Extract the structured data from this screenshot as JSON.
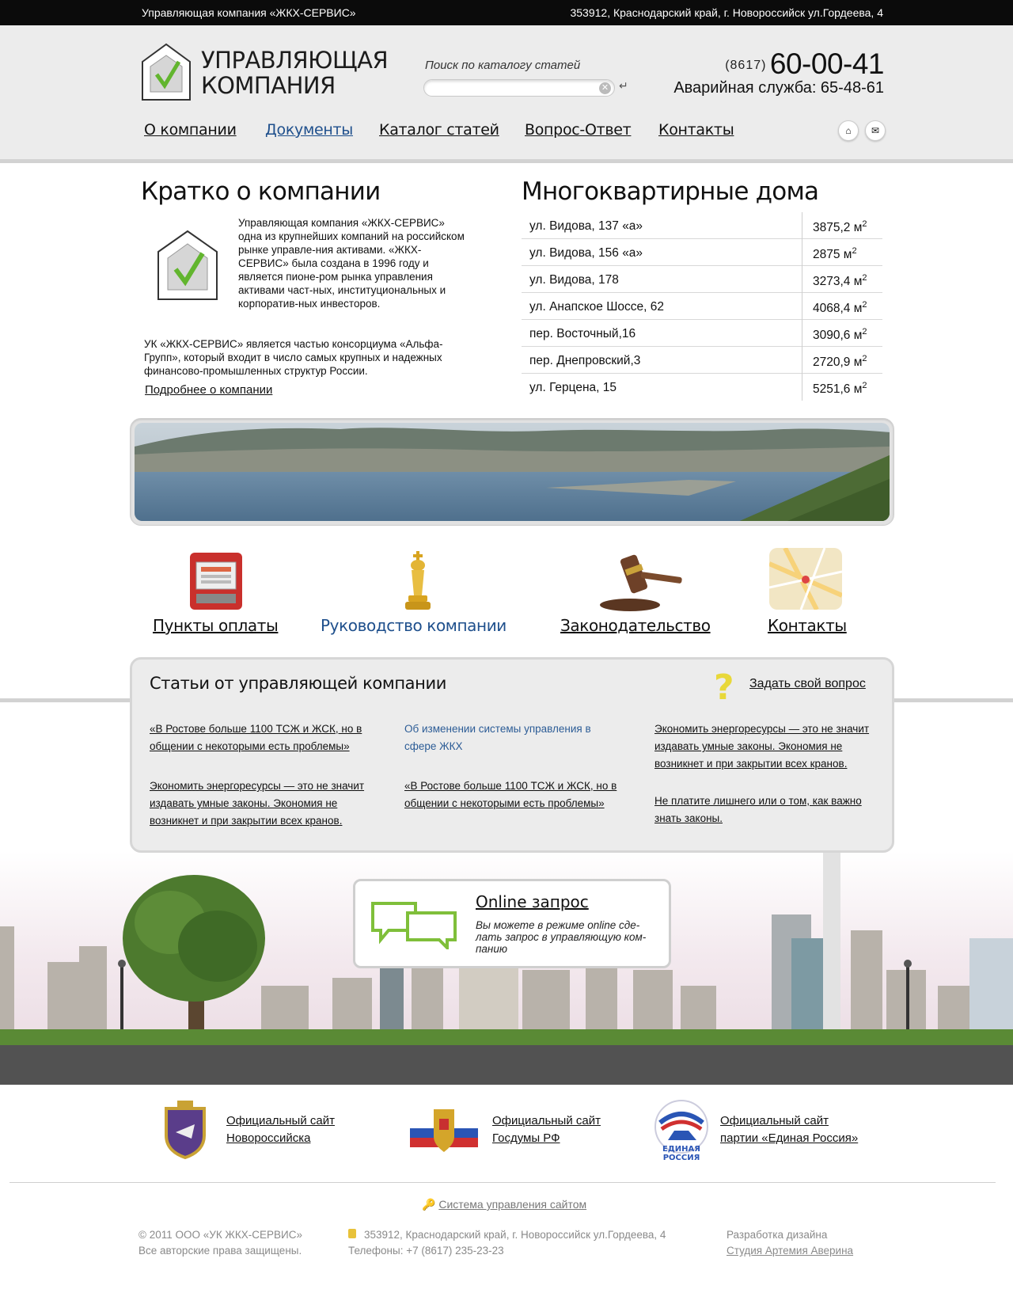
{
  "topbar": {
    "company": "Управляющая компания «ЖКХ-СЕРВИС»",
    "address": "353912, Краснодарский край, г. Новороссийск ул.Гордеева, 4"
  },
  "header": {
    "logo_line1": "УПРАВЛЯЮЩАЯ",
    "logo_line2": "КОМПАНИЯ",
    "search_label": "Поиск по каталогу статей",
    "search_value": "",
    "phone_code": "(8617)",
    "phone_number": "60-00-41",
    "emergency": "Аварийная служба: 65-48-61",
    "nav": [
      "О компании",
      "Документы",
      "Каталог статей",
      "Вопрос-Ответ",
      "Контакты"
    ],
    "icons": [
      "home-icon",
      "mail-icon"
    ]
  },
  "about": {
    "title": "Кратко о компании",
    "p1": "Управляющая компания «ЖКХ-СЕРВИС»  одна из крупнейших компаний на российском рынке управле-ния активами. «ЖКХ-СЕРВИС» была создана в 1996 году и является пионе-ром рынка управления активами част-ных, институциональных и корпоратив-ных инвесторов.",
    "p2": "УК «ЖКХ-СЕРВИС» является частью консорциума «Альфа-Групп», который входит в число самых крупных и надежных финансово-промышленных структур России.",
    "more": "Подробнее о компании"
  },
  "houses": {
    "title": "Многоквартирные дома",
    "unit": "м",
    "unit_sup": "2",
    "rows": [
      {
        "address": "ул. Видова, 137 «а»",
        "area": "3875,2"
      },
      {
        "address": "ул. Видова, 156 «а»",
        "area": "2875"
      },
      {
        "address": "ул. Видова, 178",
        "area": "3273,4"
      },
      {
        "address": "ул. Анапское Шоссе, 62",
        "area": "4068,4"
      },
      {
        "address": "пер. Восточный,16",
        "area": "3090,6"
      },
      {
        "address": "пер. Днепровский,3",
        "area": "2720,9"
      },
      {
        "address": "ул. Герцена, 15",
        "area": "5251,6"
      }
    ]
  },
  "quicklinks": [
    "Пункты оплаты",
    "Руководство компании",
    "Законодательство",
    "Контакты"
  ],
  "articles": {
    "title": "Статьи  от управляющей компании",
    "ask": "Задать свой вопрос",
    "items": [
      "«В Ростове больше 1100 ТСЖ и ЖСК, но в общении с некоторыми есть проблемы»",
      "Экономить энергоресурсы — это не значит издавать умные законы. Экономия не возникнет и при закрытии всех кранов.",
      "Об изменении системы управления в сфере ЖКХ",
      "«В Ростове больше 1100 ТСЖ и ЖСК, но в общении с некоторыми есть проблемы»",
      "Экономить энергоресурсы — это не значит издавать умные законы. Экономия не возникнет и при закрытии всех кранов.",
      "Не платите лишнего или о том, как важно знать законы."
    ]
  },
  "online": {
    "title": "Online запрос",
    "text": "Вы можете в режиме online сде-лать запрос в управляющую ком-панию"
  },
  "partners": [
    {
      "line1": "Официальный сайт",
      "line2": "Новороссийска"
    },
    {
      "line1": "Официальный сайт",
      "line2": "Госдумы РФ"
    },
    {
      "line1": "Официальный сайт",
      "line2": "партии «Единая Россия»",
      "emblem_text1": "ЕДИНАЯ",
      "emblem_text2": "РОССИЯ"
    }
  ],
  "footer": {
    "cms": "Система управления сайтом",
    "copy1": "© 2011 ООО «УК ЖКХ-СЕРВИС»",
    "copy2": "Все авторские права защищены.",
    "addr1": "353912, Краснодарский край, г. Новороссийск ул.Гордеева, 4",
    "addr2": "Телефоны: +7 (8617) 235-23-23",
    "dev1": "Разработка дизайна",
    "dev2": "Студия Артемия Аверина"
  }
}
